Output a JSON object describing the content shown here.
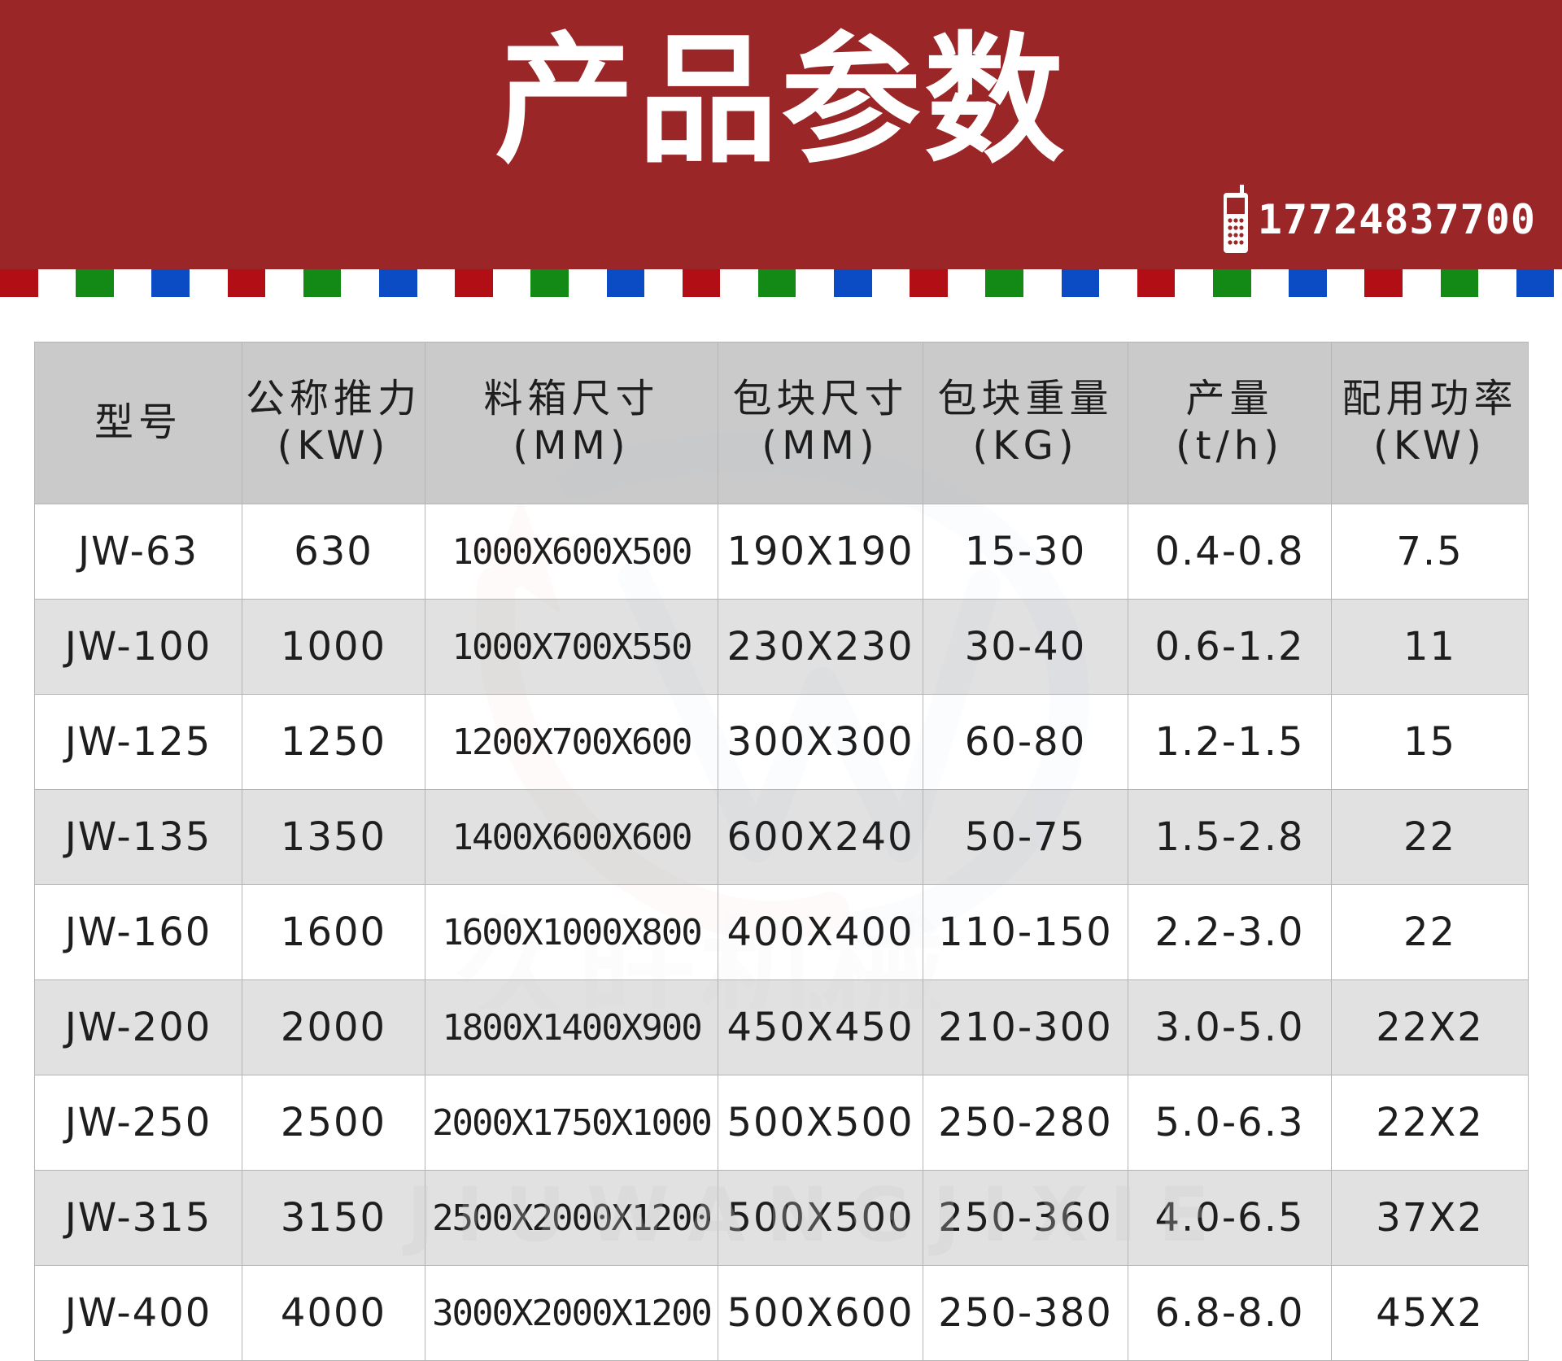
{
  "banner": {
    "title": "产品参数",
    "phone_number": "17724837700",
    "colors": {
      "background": "#9b2628",
      "text": "#ffffff"
    }
  },
  "stripe": {
    "colors": [
      "#b10f15",
      "#ffffff",
      "#138a16",
      "#ffffff",
      "#0b4bc4",
      "#ffffff"
    ]
  },
  "table": {
    "headers": [
      {
        "line1": "型号",
        "line2": ""
      },
      {
        "line1": "公称推力",
        "line2": "(KW)"
      },
      {
        "line1": "料箱尺寸",
        "line2": "(MM)"
      },
      {
        "line1": "包块尺寸",
        "line2": "(MM)"
      },
      {
        "line1": "包块重量",
        "line2": "(KG)"
      },
      {
        "line1": "产量",
        "line2": "(t/h)"
      },
      {
        "line1": "配用功率",
        "line2": "(KW)"
      }
    ],
    "rows": [
      [
        "JW-63",
        "630",
        "1000X600X500",
        "190X190",
        "15-30",
        "0.4-0.8",
        "7.5"
      ],
      [
        "JW-100",
        "1000",
        "1000X700X550",
        "230X230",
        "30-40",
        "0.6-1.2",
        "11"
      ],
      [
        "JW-125",
        "1250",
        "1200X700X600",
        "300X300",
        "60-80",
        "1.2-1.5",
        "15"
      ],
      [
        "JW-135",
        "1350",
        "1400X600X600",
        "600X240",
        "50-75",
        "1.5-2.8",
        "22"
      ],
      [
        "JW-160",
        "1600",
        "1600X1000X800",
        "400X400",
        "110-150",
        "2.2-3.0",
        "22"
      ],
      [
        "JW-200",
        "2000",
        "1800X1400X900",
        "450X450",
        "210-300",
        "3.0-5.0",
        "22X2"
      ],
      [
        "JW-250",
        "2500",
        "2000X1750X1000",
        "500X500",
        "250-280",
        "5.0-6.3",
        "22X2"
      ],
      [
        "JW-315",
        "3150",
        "2500X2000X1200",
        "500X500",
        "250-360",
        "4.0-6.5",
        "37X2"
      ],
      [
        "JW-400",
        "4000",
        "3000X2000X1200",
        "500X600",
        "250-380",
        "6.8-8.0",
        "45X2"
      ]
    ]
  },
  "watermark": {
    "brand_cn": "久旺机械",
    "brand_pinyin": "JIUWANGJIXIE"
  }
}
